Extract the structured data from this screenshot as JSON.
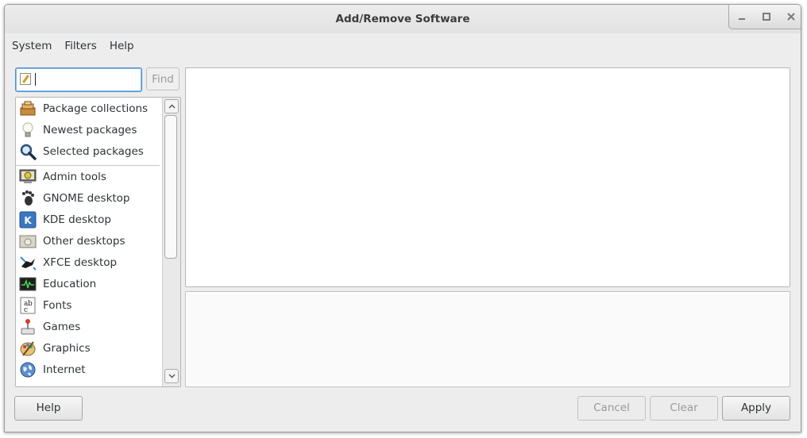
{
  "window": {
    "title": "Add/Remove Software"
  },
  "wm_buttons": {
    "minimize": "_",
    "maximize": "□",
    "close": "✕"
  },
  "menubar": {
    "items": [
      "System",
      "Filters",
      "Help"
    ]
  },
  "search": {
    "value": "",
    "find_label": "Find"
  },
  "groups": {
    "special": [
      {
        "label": "Package collections",
        "icon": "package-collections-icon"
      },
      {
        "label": "Newest packages",
        "icon": "lightbulb-icon"
      },
      {
        "label": "Selected packages",
        "icon": "magnifier-icon"
      }
    ],
    "categories": [
      {
        "label": "Admin tools",
        "icon": "admin-tools-icon"
      },
      {
        "label": "GNOME desktop",
        "icon": "gnome-foot-icon"
      },
      {
        "label": "KDE desktop",
        "icon": "kde-icon"
      },
      {
        "label": "Other desktops",
        "icon": "other-desktops-icon"
      },
      {
        "label": "XFCE desktop",
        "icon": "xfce-mouse-icon"
      },
      {
        "label": "Education",
        "icon": "education-icon"
      },
      {
        "label": "Fonts",
        "icon": "fonts-icon"
      },
      {
        "label": "Games",
        "icon": "games-icon"
      },
      {
        "label": "Graphics",
        "icon": "graphics-palette-icon"
      },
      {
        "label": "Internet",
        "icon": "internet-globe-icon"
      }
    ]
  },
  "buttons": {
    "help": "Help",
    "cancel": "Cancel",
    "clear": "Clear",
    "apply": "Apply"
  },
  "colors": {
    "window_bg": "#ededed",
    "focus": "#4a90d9",
    "disabled_text": "#9a9a9a"
  }
}
